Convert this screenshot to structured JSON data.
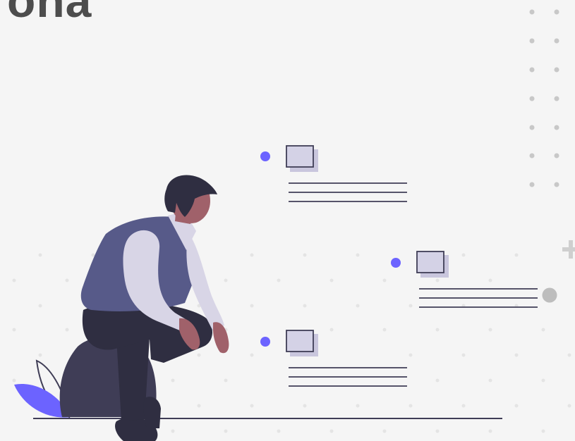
{
  "header": {
    "title_fragment": "ona"
  },
  "colors": {
    "background": "#f5f5f5",
    "accent": "#6c63ff",
    "dots": "#c8c8c8",
    "line": "#3f3d56",
    "card_fill": "#d4d2e6",
    "card_shadow": "#c9c6dd",
    "vest": "#575a89",
    "shirt": "#d8d5e6",
    "pants": "#2f2e41",
    "skin": "#a0616a",
    "hair": "#2f2e41",
    "rock": "#3f3d56"
  },
  "icons": {
    "plus": "plus-icon",
    "circle": "circle-icon"
  }
}
